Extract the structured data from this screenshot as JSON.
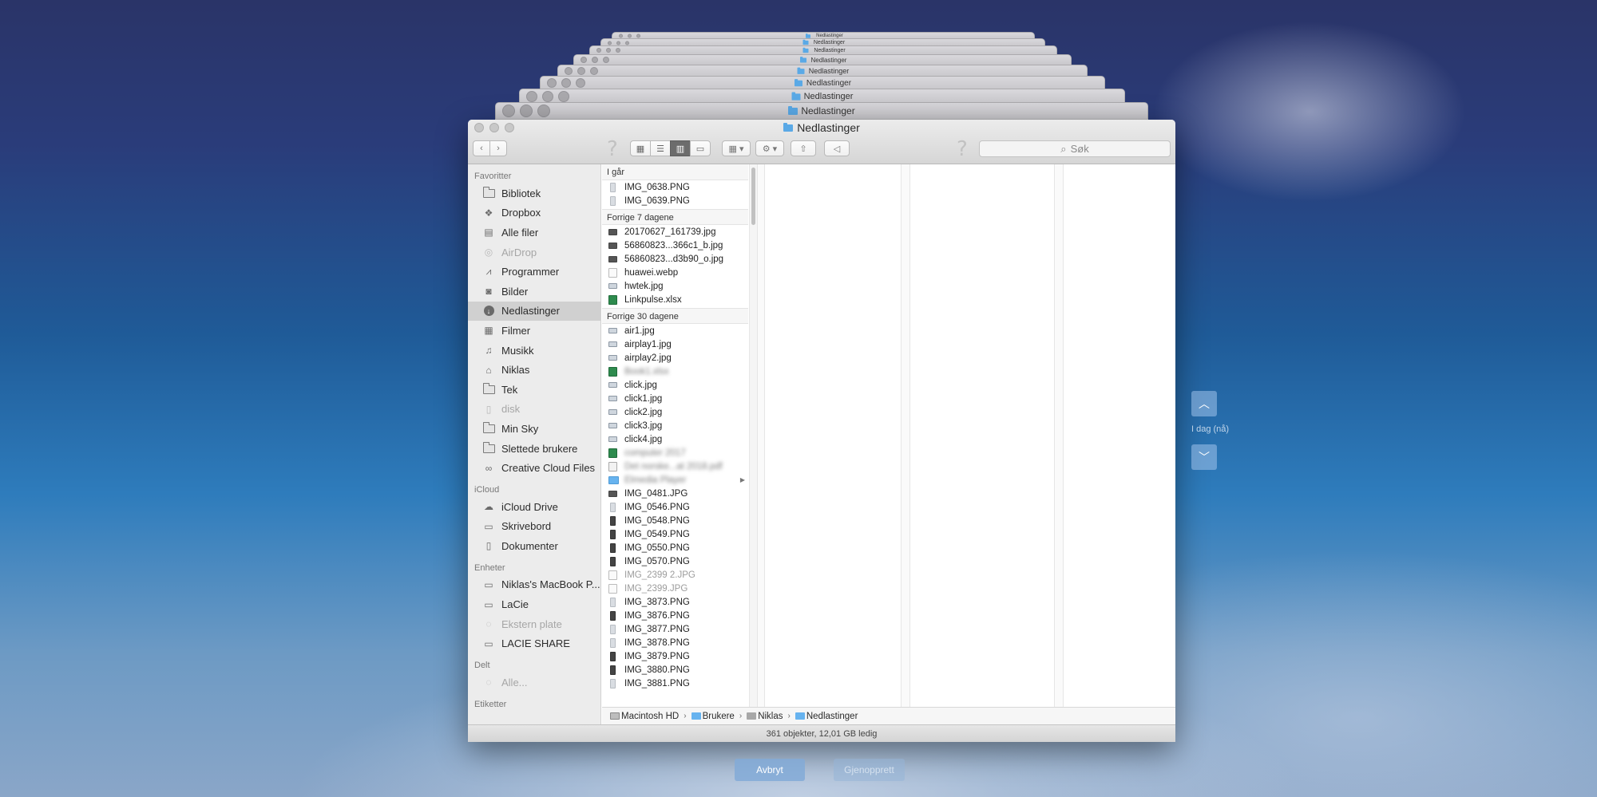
{
  "window": {
    "title": "Nedlastinger",
    "stack_titles": [
      "Nedlastinger",
      "Nedlastinger",
      "Nedlastinger",
      "Nedlastinger",
      "Nedlastinger",
      "Nedlastinger",
      "Nedlastinger",
      "Nedlastinger"
    ]
  },
  "toolbar": {
    "back_icon": "chevron-left-icon",
    "forward_icon": "chevron-right-icon",
    "views": [
      "icon-view",
      "list-view",
      "column-view",
      "coverflow-view"
    ],
    "active_view": "column-view",
    "search_placeholder": "Søk"
  },
  "sidebar": {
    "sections": [
      {
        "title": "Favoritter",
        "items": [
          {
            "label": "Bibliotek",
            "icon": "folder-icon"
          },
          {
            "label": "Dropbox",
            "icon": "dropbox-icon"
          },
          {
            "label": "Alle filer",
            "icon": "all-files-icon"
          },
          {
            "label": "AirDrop",
            "icon": "airdrop-icon",
            "dim": true
          },
          {
            "label": "Programmer",
            "icon": "applications-icon"
          },
          {
            "label": "Bilder",
            "icon": "camera-icon"
          },
          {
            "label": "Nedlastinger",
            "icon": "downloads-icon",
            "selected": true
          },
          {
            "label": "Filmer",
            "icon": "film-icon"
          },
          {
            "label": "Musikk",
            "icon": "music-icon"
          },
          {
            "label": "Niklas",
            "icon": "home-icon"
          },
          {
            "label": "Tek",
            "icon": "folder-icon"
          },
          {
            "label": "disk",
            "icon": "document-icon",
            "dim": true
          },
          {
            "label": "Min Sky",
            "icon": "folder-icon"
          },
          {
            "label": "Slettede brukere",
            "icon": "folder-icon"
          },
          {
            "label": "Creative Cloud Files",
            "icon": "creative-cloud-icon"
          }
        ]
      },
      {
        "title": "iCloud",
        "items": [
          {
            "label": "iCloud Drive",
            "icon": "cloud-icon"
          },
          {
            "label": "Skrivebord",
            "icon": "desktop-icon"
          },
          {
            "label": "Dokumenter",
            "icon": "document-icon"
          }
        ]
      },
      {
        "title": "Enheter",
        "items": [
          {
            "label": "Niklas's MacBook P...",
            "icon": "laptop-icon"
          },
          {
            "label": "LaCie",
            "icon": "drive-icon"
          },
          {
            "label": "Ekstern plate",
            "icon": "disc-icon",
            "dim": true
          },
          {
            "label": "LACIE SHARE",
            "icon": "server-icon"
          }
        ]
      },
      {
        "title": "Delt",
        "items": [
          {
            "label": "Alle...",
            "icon": "network-icon",
            "dim": true
          }
        ]
      },
      {
        "title": "Etiketter",
        "items": []
      }
    ]
  },
  "files": {
    "groups": [
      {
        "title": "I går",
        "items": [
          {
            "name": "IMG_0638.PNG",
            "kind": "phonel"
          },
          {
            "name": "IMG_0639.PNG",
            "kind": "phonel"
          }
        ]
      },
      {
        "title": "Forrige 7 dagene",
        "items": [
          {
            "name": "20170627_161739.jpg",
            "kind": "img"
          },
          {
            "name": "56860823...366c1_b.jpg",
            "kind": "img"
          },
          {
            "name": "56860823...d3b90_o.jpg",
            "kind": "img"
          },
          {
            "name": "huawei.webp",
            "kind": "doc"
          },
          {
            "name": "hwtek.jpg",
            "kind": "imgl"
          },
          {
            "name": "Linkpulse.xlsx",
            "kind": "xls"
          }
        ]
      },
      {
        "title": "Forrige 30 dagene",
        "items": [
          {
            "name": "air1.jpg",
            "kind": "imgl"
          },
          {
            "name": "airplay1.jpg",
            "kind": "imgl"
          },
          {
            "name": "airplay2.jpg",
            "kind": "imgl"
          },
          {
            "name": "Book1.xlsx",
            "kind": "xls",
            "blur": true
          },
          {
            "name": "click.jpg",
            "kind": "imgl"
          },
          {
            "name": "click1.jpg",
            "kind": "imgl"
          },
          {
            "name": "click2.jpg",
            "kind": "imgl"
          },
          {
            "name": "click3.jpg",
            "kind": "imgl"
          },
          {
            "name": "click4.jpg",
            "kind": "imgl"
          },
          {
            "name": "computer 2017",
            "kind": "xls",
            "blur": true
          },
          {
            "name": "Det norske...at 2018.pdf",
            "kind": "pdf",
            "blur": true
          },
          {
            "name": "Elmedia Player",
            "kind": "folder",
            "blur": true,
            "has_children": true
          },
          {
            "name": "IMG_0481.JPG",
            "kind": "img"
          },
          {
            "name": "IMG_0546.PNG",
            "kind": "phonel"
          },
          {
            "name": "IMG_0548.PNG",
            "kind": "phone"
          },
          {
            "name": "IMG_0549.PNG",
            "kind": "phone"
          },
          {
            "name": "IMG_0550.PNG",
            "kind": "phone"
          },
          {
            "name": "IMG_0570.PNG",
            "kind": "phone"
          },
          {
            "name": "IMG_2399 2.JPG",
            "kind": "doc",
            "dim": true
          },
          {
            "name": "IMG_2399.JPG",
            "kind": "doc",
            "dim": true
          },
          {
            "name": "IMG_3873.PNG",
            "kind": "phonel"
          },
          {
            "name": "IMG_3876.PNG",
            "kind": "phone"
          },
          {
            "name": "IMG_3877.PNG",
            "kind": "phonel"
          },
          {
            "name": "IMG_3878.PNG",
            "kind": "phonel"
          },
          {
            "name": "IMG_3879.PNG",
            "kind": "phone"
          },
          {
            "name": "IMG_3880.PNG",
            "kind": "phone"
          },
          {
            "name": "IMG_3881.PNG",
            "kind": "phonel"
          }
        ]
      }
    ]
  },
  "pathbar": {
    "segments": [
      "Macintosh HD",
      "Brukere",
      "Niklas",
      "Nedlastinger"
    ]
  },
  "statusbar": {
    "text": "361 objekter, 12,01 GB ledig"
  },
  "timemachine": {
    "label": "I dag (nå)",
    "up_icon": "chevron-up-icon",
    "down_icon": "chevron-down-icon",
    "cancel_label": "Avbryt",
    "restore_label": "Gjenopprett"
  }
}
